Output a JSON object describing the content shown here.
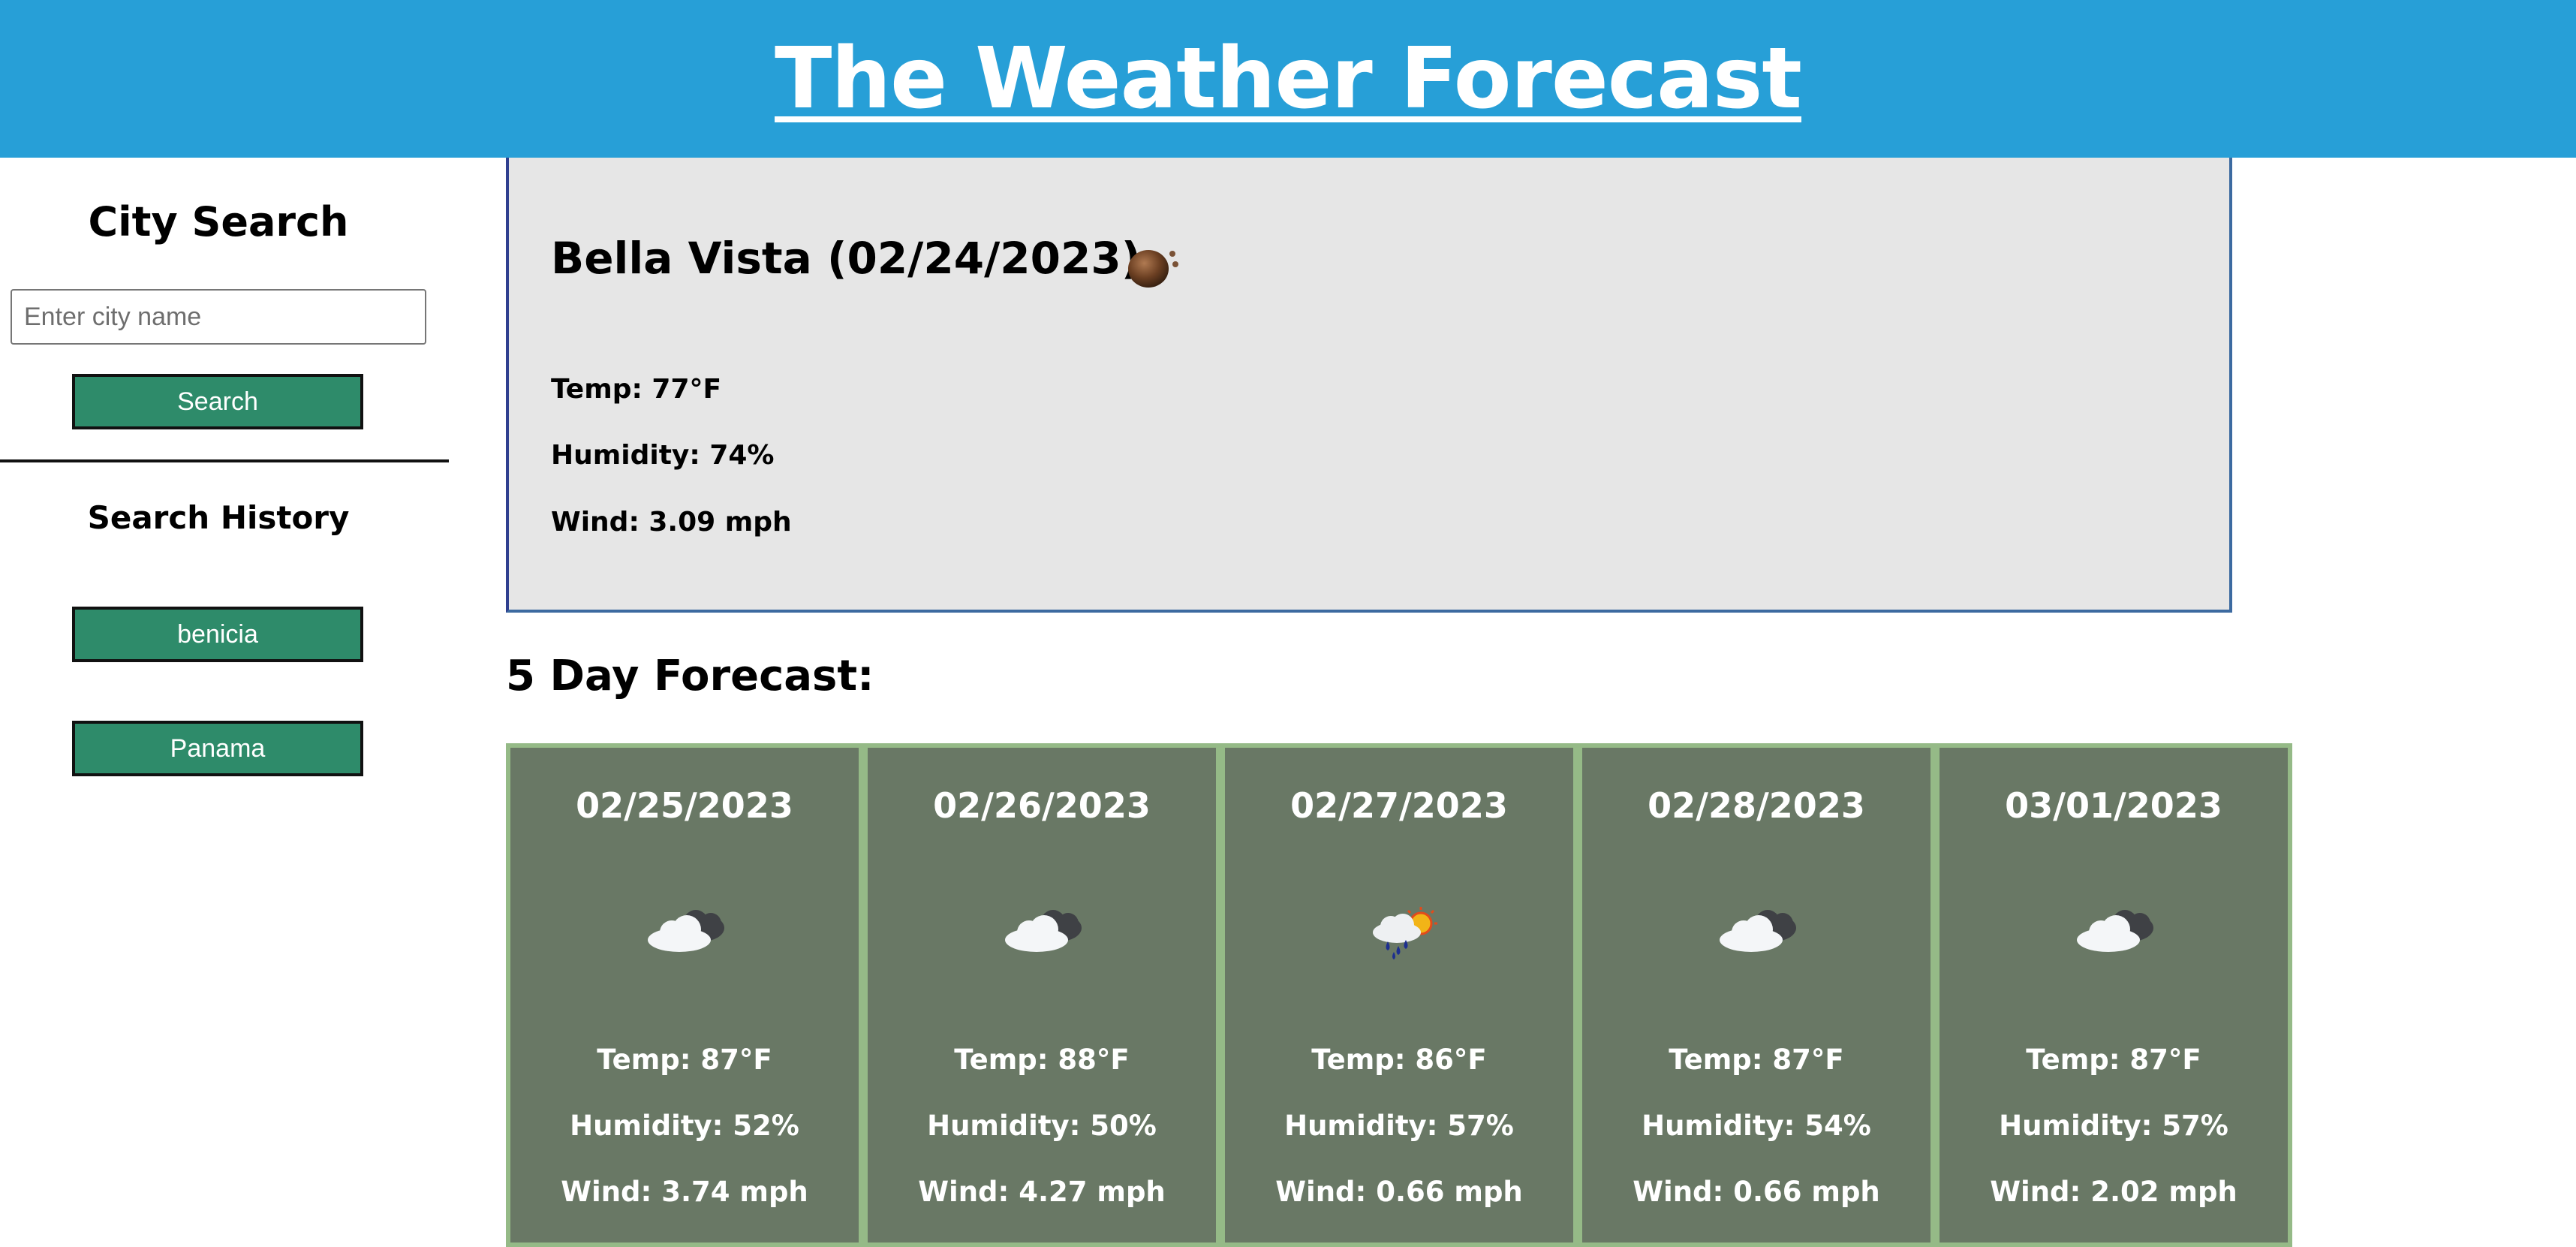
{
  "header": {
    "title": "The Weather Forecast"
  },
  "sidebar": {
    "search_title": "City Search",
    "search_placeholder": "Enter city name",
    "search_button": "Search",
    "history_title": "Search History",
    "history": [
      "benicia",
      "Panama"
    ]
  },
  "current": {
    "city_date": "Bella Vista (02/24/2023)",
    "icon": "haze-icon",
    "temp": "Temp: 77°F",
    "humidity": "Humidity: 74%",
    "wind": "Wind: 3.09 mph"
  },
  "forecast": {
    "title": "5 Day Forecast:",
    "days": [
      {
        "date": "02/25/2023",
        "icon": "broken-clouds-icon",
        "temp": "Temp: 87°F",
        "humidity": "Humidity: 52%",
        "wind": "Wind: 3.74 mph"
      },
      {
        "date": "02/26/2023",
        "icon": "broken-clouds-icon",
        "temp": "Temp: 88°F",
        "humidity": "Humidity: 50%",
        "wind": "Wind: 4.27 mph"
      },
      {
        "date": "02/27/2023",
        "icon": "rain-sun-icon",
        "temp": "Temp: 86°F",
        "humidity": "Humidity: 57%",
        "wind": "Wind: 0.66 mph"
      },
      {
        "date": "02/28/2023",
        "icon": "broken-clouds-icon",
        "temp": "Temp: 87°F",
        "humidity": "Humidity: 54%",
        "wind": "Wind: 0.66 mph"
      },
      {
        "date": "03/01/2023",
        "icon": "broken-clouds-icon",
        "temp": "Temp: 87°F",
        "humidity": "Humidity: 57%",
        "wind": "Wind: 2.02 mph"
      }
    ]
  },
  "colors": {
    "header_bg": "#279fd7",
    "button_bg": "#2e8b6a",
    "card_bg": "#697865",
    "card_border": "#95ba87",
    "current_bg": "#e6e6e6"
  }
}
